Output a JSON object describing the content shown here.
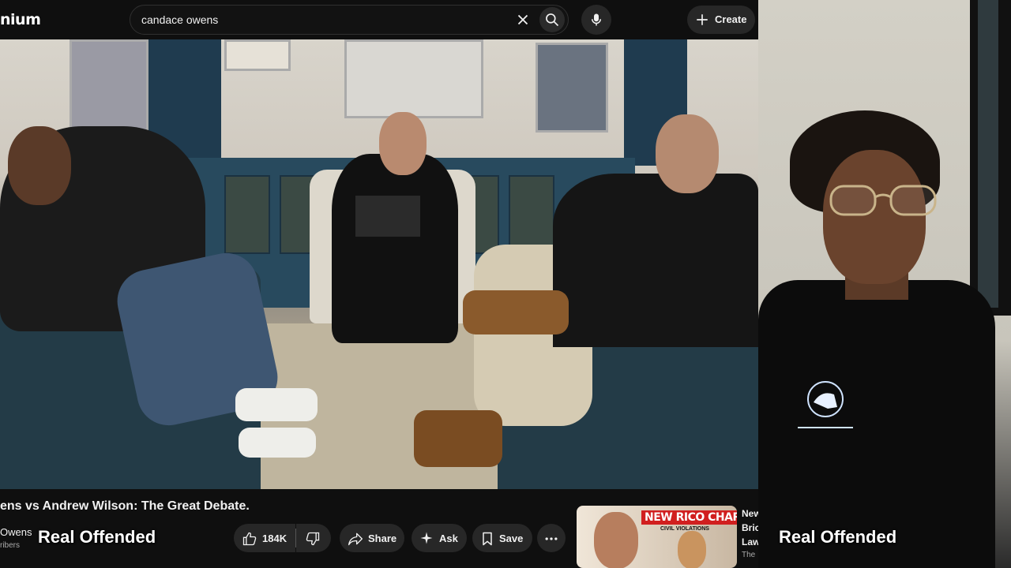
{
  "youtube": {
    "logo_fragment": "nium",
    "search": {
      "query": "candace owens"
    },
    "create_label": "Create",
    "video_title": "ens vs Andrew Wilson: The Great Debate.",
    "channel": {
      "name": "Owens",
      "subscribers_fragment": "ribers"
    },
    "actions": {
      "like_count": "184K",
      "share_label": "Share",
      "ask_label": "Ask",
      "save_label": "Save"
    },
    "suggested": {
      "thumbnail_headline": "NEW RICO CHARGES!",
      "thumbnail_subtext": "CIVIL VIOLATIONS",
      "title_lines": [
        "New",
        "Bric",
        "Law"
      ],
      "meta_fragment": "The"
    }
  },
  "overlays": {
    "left_name": "Real Offended",
    "right_name": "Real Offended"
  },
  "colors": {
    "youtube_bg": "#0f0f0f",
    "button_bg": "#272727",
    "thumbnail_red": "#d11f1f"
  }
}
